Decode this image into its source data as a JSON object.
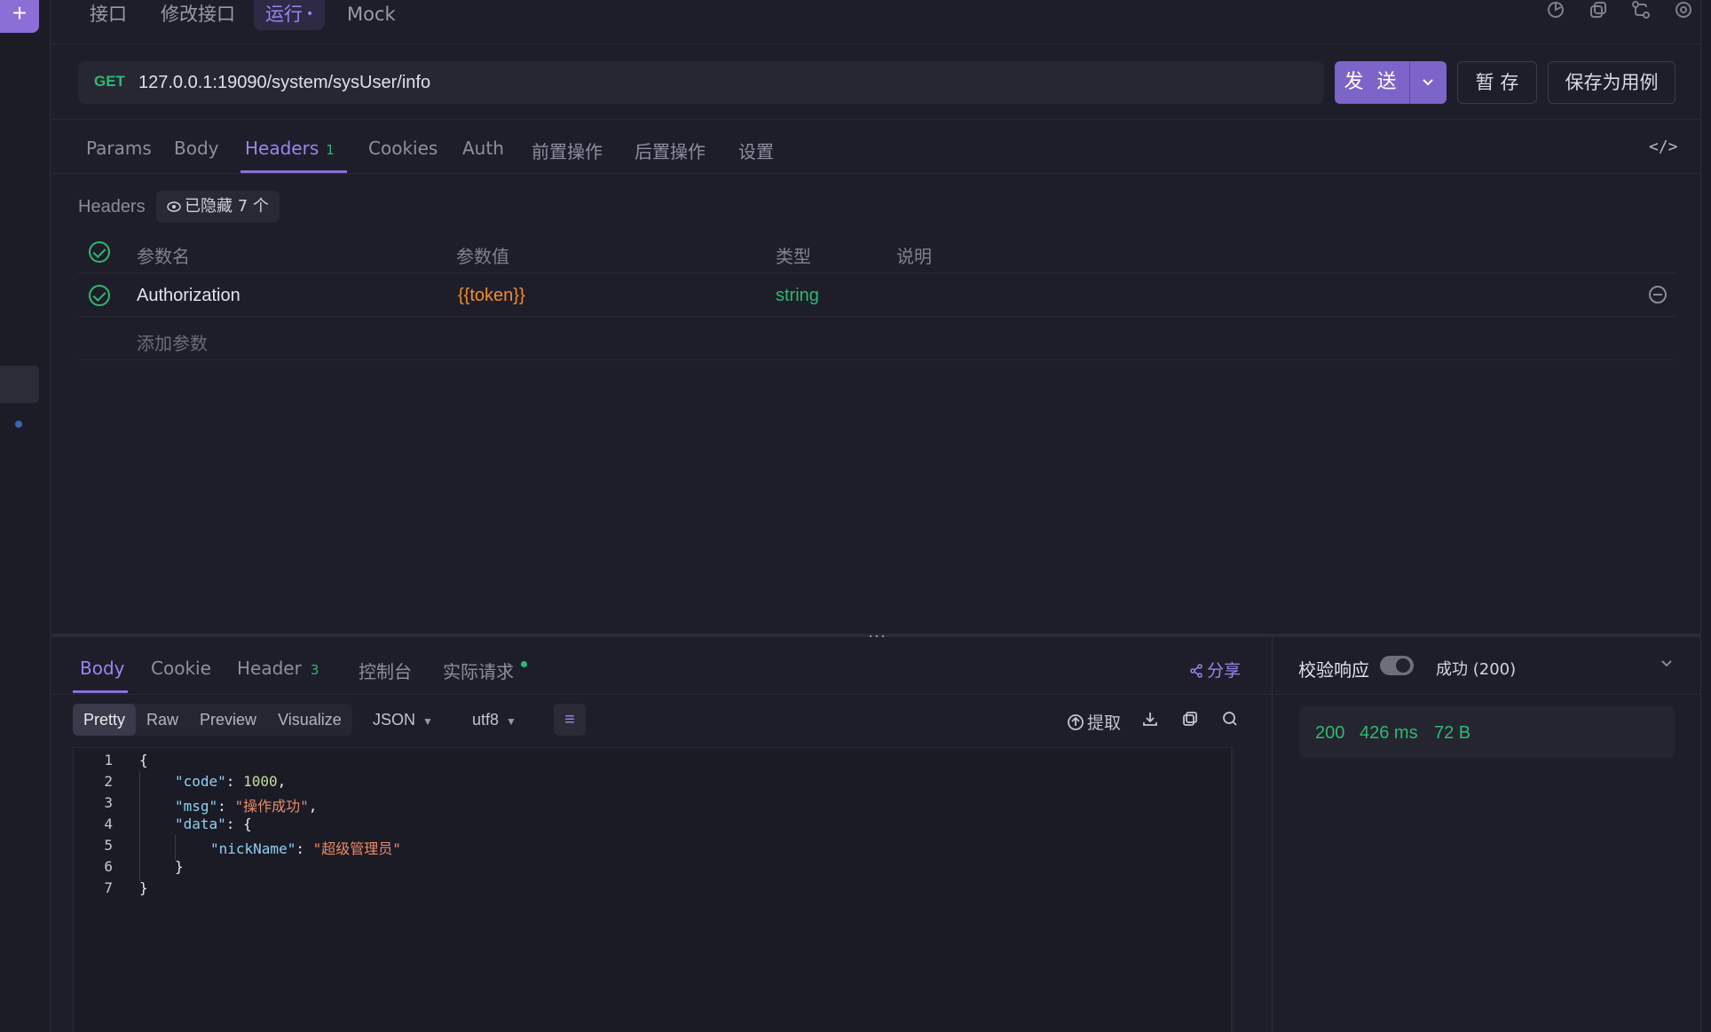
{
  "top_tabs": [
    {
      "label": "接口",
      "active": false
    },
    {
      "label": "修改接口",
      "active": false
    },
    {
      "label": "运行",
      "active": true,
      "mark": "•"
    },
    {
      "label": "Mock",
      "active": false
    }
  ],
  "request": {
    "method": "GET",
    "url": "127.0.0.1:19090/system/sysUser/info",
    "send_label": "发 送",
    "save_temp_label": "暂 存",
    "save_case_label": "保存为用例"
  },
  "request_tabs": [
    "Params",
    "Body",
    "Headers",
    "Cookies",
    "Auth",
    "前置操作",
    "后置操作",
    "设置"
  ],
  "headers_count": "1",
  "headers_section": {
    "label": "Headers",
    "hidden_chip": "已隐藏 7 个",
    "columns": [
      "参数名",
      "参数值",
      "类型",
      "说明"
    ],
    "rows": [
      {
        "name": "Authorization",
        "value": "{{token}}",
        "type": "string",
        "desc": ""
      }
    ],
    "add_placeholder": "添加参数"
  },
  "response": {
    "tabs": [
      "Body",
      "Cookie",
      "Header",
      "控制台",
      "实际请求"
    ],
    "header_count": "3",
    "share_label": "分享",
    "view_modes": [
      "Pretty",
      "Raw",
      "Preview",
      "Visualize"
    ],
    "format": "JSON",
    "encoding": "utf8",
    "extract_label": "提取",
    "line_numbers": [
      "1",
      "2",
      "3",
      "4",
      "5",
      "6",
      "7"
    ],
    "json": {
      "code_key": "\"code\"",
      "code_value": "1000",
      "msg_key": "\"msg\"",
      "msg_value": "\"操作成功\"",
      "data_key": "\"data\"",
      "nick_key": "\"nickName\"",
      "nick_value": "\"超级管理员\""
    }
  },
  "validation": {
    "label": "校验响应",
    "status_text": "成功 (200)",
    "status_code": "200",
    "time": "426 ms",
    "size": "72 B"
  },
  "colors": {
    "accent": "#8b6fd6",
    "success": "#2fb971",
    "token": "#f28c28"
  }
}
